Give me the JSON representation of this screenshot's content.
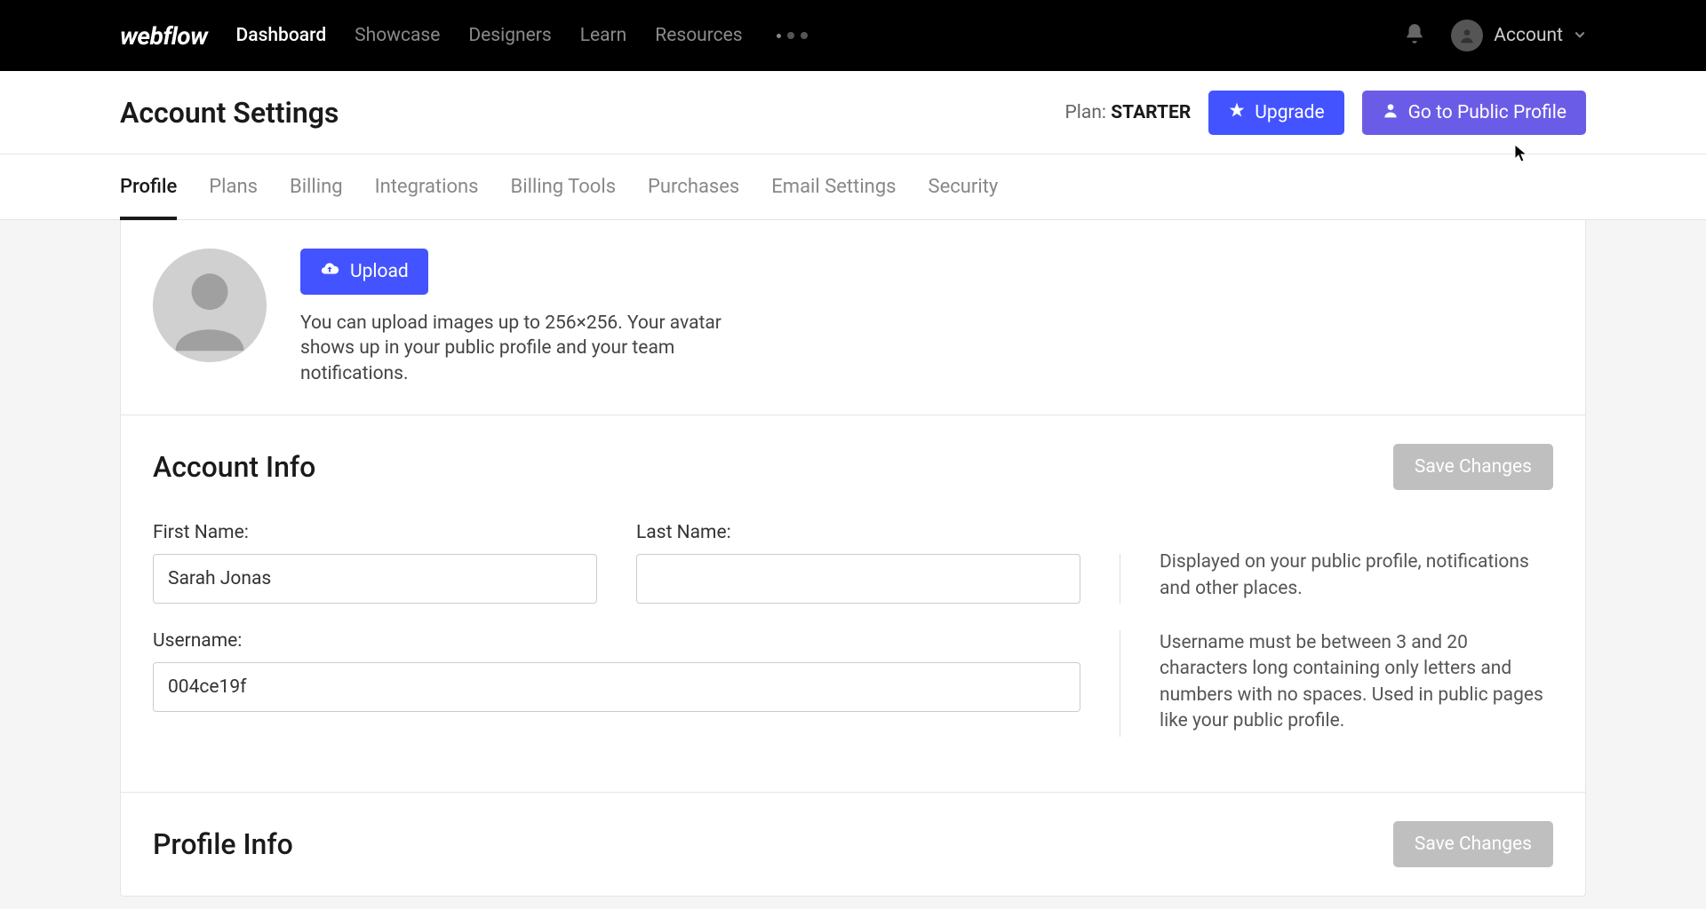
{
  "topbar": {
    "logo_text": "webflow",
    "nav": [
      {
        "label": "Dashboard",
        "active": true
      },
      {
        "label": "Showcase",
        "active": false
      },
      {
        "label": "Designers",
        "active": false
      },
      {
        "label": "Learn",
        "active": false
      },
      {
        "label": "Resources",
        "active": false,
        "has_dropdown": true
      }
    ],
    "account_label": "Account"
  },
  "page_header": {
    "title": "Account Settings",
    "plan_prefix": "Plan: ",
    "plan_name": "STARTER",
    "upgrade_label": "Upgrade",
    "public_profile_label": "Go to Public Profile"
  },
  "tabs": [
    {
      "label": "Profile",
      "active": true
    },
    {
      "label": "Plans",
      "active": false
    },
    {
      "label": "Billing",
      "active": false
    },
    {
      "label": "Integrations",
      "active": false
    },
    {
      "label": "Billing Tools",
      "active": false
    },
    {
      "label": "Purchases",
      "active": false
    },
    {
      "label": "Email Settings",
      "active": false
    },
    {
      "label": "Security",
      "active": false
    }
  ],
  "avatar_section": {
    "upload_label": "Upload",
    "hint": "You can upload images up to 256×256. Your avatar shows up in your public profile and your team notifications."
  },
  "account_info": {
    "title": "Account Info",
    "save_label": "Save Changes",
    "first_name_label": "First Name:",
    "first_name_value": "Sarah Jonas",
    "last_name_label": "Last Name:",
    "last_name_value": "",
    "name_help": "Displayed on your public profile, notifications and other places.",
    "username_label": "Username:",
    "username_value": "004ce19f",
    "username_help": "Username must be between 3 and 20 characters long containing only letters and numbers with no spaces. Used in public pages like your public profile."
  },
  "profile_info": {
    "title": "Profile Info",
    "save_label": "Save Changes"
  }
}
